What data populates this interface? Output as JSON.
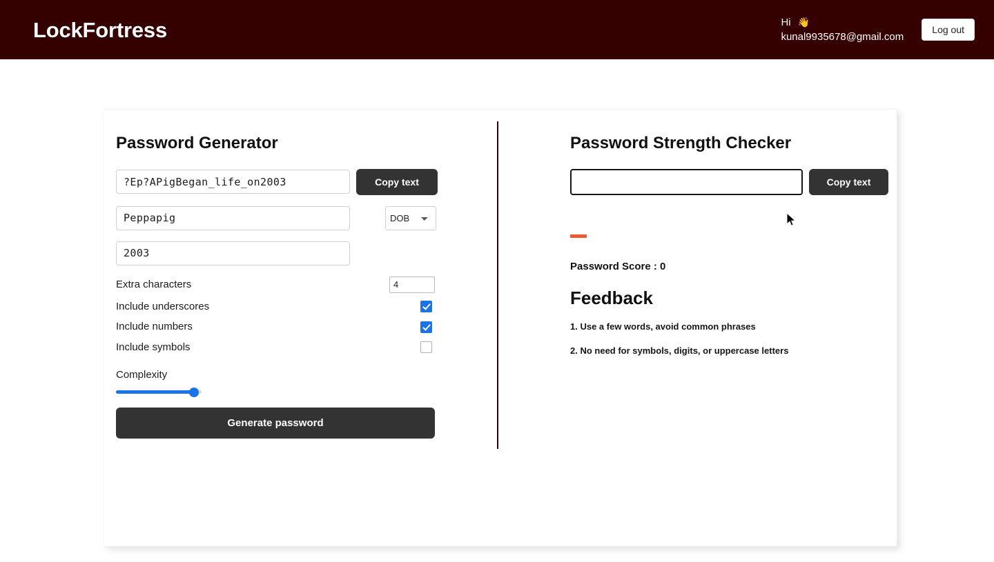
{
  "header": {
    "brand": "LockFortress",
    "greeting": "Hi",
    "wave_emoji": "👋",
    "email": "kunal9935678@gmail.com",
    "logout_label": "Log out",
    "background_color": "#350000"
  },
  "generator": {
    "title": "Password Generator",
    "password_value": "?Ep?APigBegan_life_on2003",
    "password_placeholder": "",
    "copy_label": "Copy text",
    "name_value": "Peppapig",
    "name_placeholder": "",
    "category_selected": "DOB",
    "category_options": [
      "DOB"
    ],
    "year_value": "2003",
    "year_placeholder": "",
    "extra_characters_label": "Extra characters",
    "extra_characters_value": "4",
    "include_underscores_label": "Include underscores",
    "include_underscores_checked": true,
    "include_numbers_label": "Include numbers",
    "include_numbers_checked": true,
    "include_symbols_label": "Include symbols",
    "include_symbols_checked": false,
    "complexity_label": "Complexity",
    "complexity_percent": 92,
    "generate_label": "Generate password",
    "accent_color": "#1a73e8",
    "button_color": "#333333"
  },
  "checker": {
    "title": "Password Strength Checker",
    "input_value": "",
    "input_placeholder": "",
    "copy_label": "Copy text",
    "strength_color": "#ee5a32",
    "score_label": "Password Score : 0",
    "feedback_title": "Feedback",
    "feedback_items": [
      "1. Use a few words, avoid common phrases",
      "2. No need for symbols, digits, or uppercase letters"
    ]
  }
}
